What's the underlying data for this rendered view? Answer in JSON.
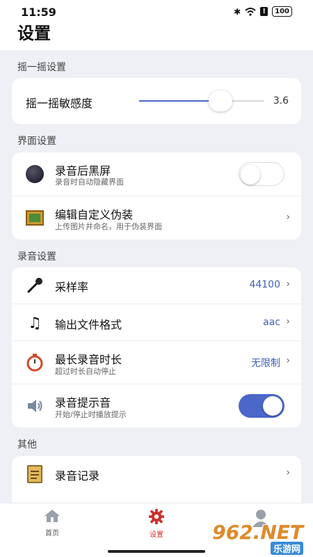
{
  "status": {
    "time": "11:59",
    "battery": "100"
  },
  "page": {
    "title": "设置"
  },
  "shake": {
    "section": "摇一摇设置",
    "sensitivity_label": "摇一摇敏感度",
    "sensitivity_value": "3.6",
    "slider_fraction": 0.65
  },
  "ui": {
    "section": "界面设置",
    "items": [
      {
        "title": "录音后黑屏",
        "subtitle": "录音时自动隐藏界面",
        "icon": "black-screen-icon",
        "toggle": false
      },
      {
        "title": "编辑自定义伪装",
        "subtitle": "上传图片并命名，用于伪装界面",
        "icon": "picture-frame-icon"
      }
    ]
  },
  "recording": {
    "section": "录音设置",
    "items": [
      {
        "title": "采样率",
        "value": "44100",
        "icon": "microphone-icon"
      },
      {
        "title": "输出文件格式",
        "value": "aac",
        "icon": "music-note-icon"
      },
      {
        "title": "最长录音时长",
        "subtitle": "超过时长自动停止",
        "value": "无限制",
        "icon": "stopwatch-icon"
      },
      {
        "title": "录音提示音",
        "subtitle": "开始/停止时播放提示",
        "icon": "speaker-icon",
        "toggle": true
      }
    ]
  },
  "other": {
    "section": "其他",
    "items": [
      {
        "title": "录音记录",
        "icon": "clipboard-icon"
      }
    ]
  },
  "tabbar": {
    "tabs": [
      {
        "label": "首页",
        "icon": "home-icon"
      },
      {
        "label": "设置",
        "icon": "gear-icon",
        "active": true
      },
      {
        "label": "",
        "icon": "profile-icon"
      }
    ]
  },
  "watermark": {
    "brand": "962.NET",
    "sub": "乐游网"
  },
  "colors": {
    "accent": "#4a67c9",
    "active_tab": "#c8302c",
    "background": "#eef0f5"
  }
}
